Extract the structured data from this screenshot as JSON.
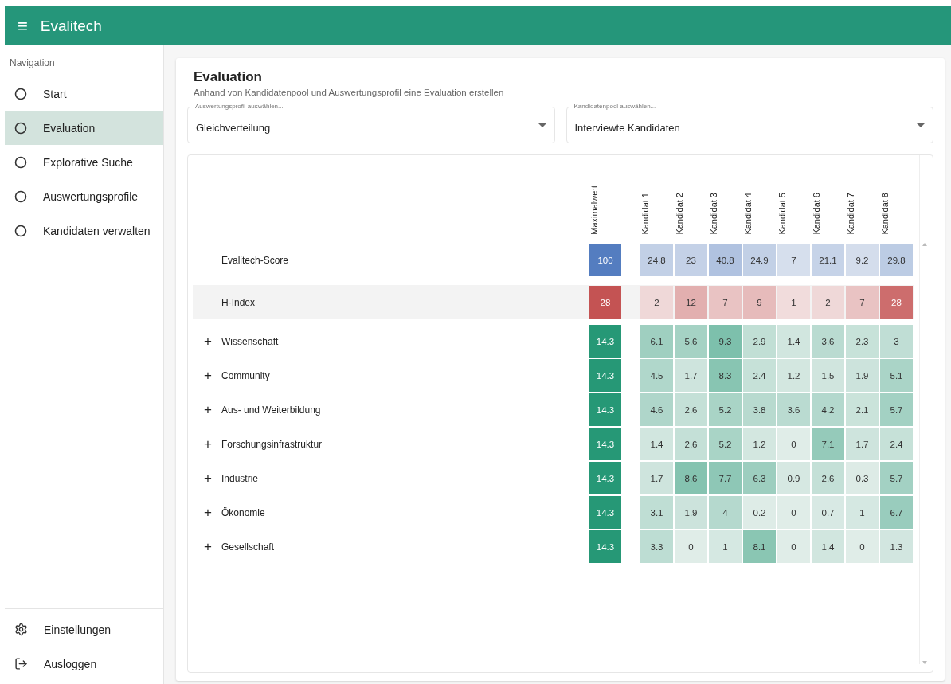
{
  "app_bar": {
    "menu": "≡",
    "title": "Evalitech"
  },
  "sidebar": {
    "heading": "Navigation",
    "items": [
      {
        "label": "Start",
        "selected": false
      },
      {
        "label": "Evaluation",
        "selected": true
      },
      {
        "label": "Explorative Suche",
        "selected": false
      },
      {
        "label": "Auswertungsprofile",
        "selected": false
      },
      {
        "label": "Kandidaten verwalten",
        "selected": false
      }
    ],
    "footer_items": [
      {
        "label": "Einstellungen",
        "kind": "settings"
      },
      {
        "label": "Ausloggen",
        "kind": "logout"
      }
    ]
  },
  "page": {
    "title": "Evaluation",
    "subtitle": "Anhand von Kandidatenpool und Auswertungsprofil eine Evaluation erstellen"
  },
  "selects": [
    {
      "label": "Auswertungsprofil auswählen...",
      "value": "Gleichverteilung"
    },
    {
      "label": "Kandidatenpool auswählen...",
      "value": "Interviewte Kandidaten"
    }
  ],
  "table": {
    "max_column": "Maximalwert",
    "columns": [
      "Kandidat 1",
      "Kandidat 2",
      "Kandidat 3",
      "Kandidat 4",
      "Kandidat 5",
      "Kandidat 6",
      "Kandidat 7",
      "Kandidat 8"
    ],
    "rows": [
      {
        "label": "Evalitech-Score",
        "kind": "score",
        "selected": false,
        "max": "100",
        "values": [
          "24.8",
          "23",
          "40.8",
          "24.9",
          "7",
          "21.1",
          "9.2",
          "29.8"
        ]
      },
      {
        "label": "H-Index",
        "kind": "hindex",
        "selected": true,
        "max": "28",
        "values": [
          "2",
          "12",
          "7",
          "9",
          "1",
          "2",
          "7",
          "28"
        ]
      },
      {
        "label": "Wissenschaft",
        "kind": "category",
        "expander": "+",
        "selected": false,
        "max": "14.3",
        "values": [
          "6.1",
          "5.6",
          "9.3",
          "2.9",
          "1.4",
          "3.6",
          "2.3",
          "3"
        ]
      },
      {
        "label": "Community",
        "kind": "category",
        "expander": "+",
        "selected": false,
        "max": "14.3",
        "values": [
          "4.5",
          "1.7",
          "8.3",
          "2.4",
          "1.2",
          "1.5",
          "1.9",
          "5.1"
        ]
      },
      {
        "label": "Aus- und Weiterbildung",
        "kind": "category",
        "expander": "+",
        "selected": false,
        "max": "14.3",
        "values": [
          "4.6",
          "2.6",
          "5.2",
          "3.8",
          "3.6",
          "4.2",
          "2.1",
          "5.7"
        ]
      },
      {
        "label": "Forschungsinfrastruktur",
        "kind": "category",
        "expander": "+",
        "selected": false,
        "max": "14.3",
        "values": [
          "1.4",
          "2.6",
          "5.2",
          "1.2",
          "0",
          "7.1",
          "1.7",
          "2.4"
        ]
      },
      {
        "label": "Industrie",
        "kind": "category",
        "expander": "+",
        "selected": false,
        "max": "14.3",
        "values": [
          "1.7",
          "8.6",
          "7.7",
          "6.3",
          "0.9",
          "2.6",
          "0.3",
          "5.7"
        ]
      },
      {
        "label": "Ökonomie",
        "kind": "category",
        "expander": "+",
        "selected": false,
        "max": "14.3",
        "values": [
          "3.1",
          "1.9",
          "4",
          "0.2",
          "0",
          "0.7",
          "1",
          "6.7"
        ]
      },
      {
        "label": "Gesellschaft",
        "kind": "category",
        "expander": "+",
        "selected": false,
        "max": "14.3",
        "values": [
          "3.3",
          "0",
          "1",
          "8.1",
          "0",
          "1.4",
          "0",
          "1.3"
        ]
      }
    ]
  }
}
